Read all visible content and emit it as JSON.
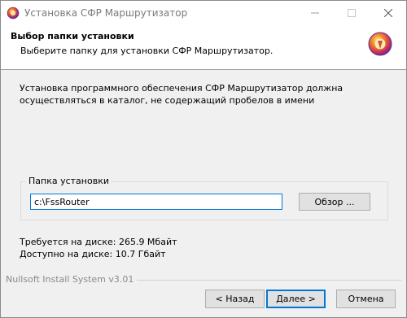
{
  "window": {
    "title": "Установка СФР Маршрутизатор"
  },
  "header": {
    "title": "Выбор папки установки",
    "subtitle": "Выберите папку для установки СФР Маршрутизатор."
  },
  "body": {
    "description": "Установка программного обеспечения СФР Маршрутизатор должна осуществляться в каталог, не содержащий пробелов в имени",
    "group_label": "Папка установки",
    "path_value": "c:\\FssRouter",
    "browse_label": "Обзор ...",
    "space_required": "Требуется на диске: 265.9 Мбайт",
    "space_available": "Доступно на диске: 10.7 Гбайт"
  },
  "footer": {
    "brand": "Nullsoft Install System v3.01",
    "back_label": "< Назад",
    "next_label": "Далее >",
    "cancel_label": "Отмена"
  },
  "icons": {
    "app": "installer-icon",
    "logo": "installer-logo-icon",
    "minimize": "minimize-icon",
    "maximize": "maximize-icon",
    "close": "close-icon"
  },
  "colors": {
    "accent": "#0078d7",
    "button_face": "#e1e1e1",
    "window_bg": "#f0f0f0"
  }
}
